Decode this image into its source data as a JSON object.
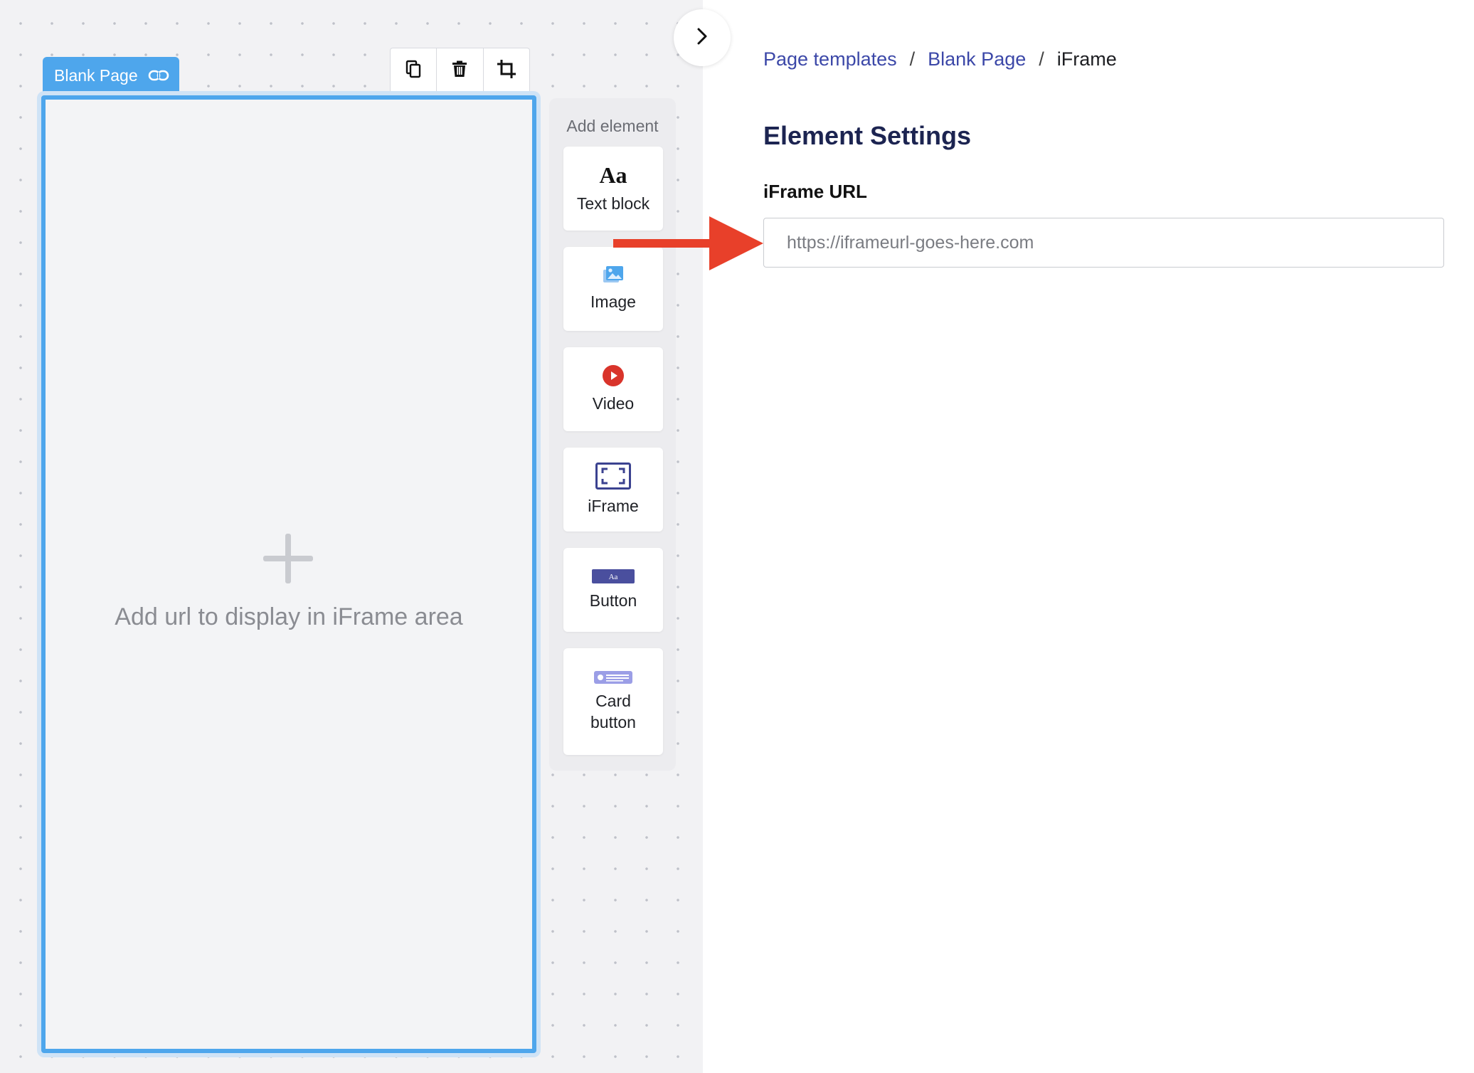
{
  "page_tab": {
    "label": "Blank Page",
    "icon": "link-icon"
  },
  "toolbar": {
    "tools": [
      "copy-icon",
      "trash-icon",
      "crop-icon"
    ]
  },
  "canvas": {
    "placeholder_text": "Add url to display in iFrame area"
  },
  "add_element": {
    "title": "Add element",
    "items": [
      {
        "label": "Text block",
        "icon": "text-block-icon"
      },
      {
        "label": "Image",
        "icon": "image-icon"
      },
      {
        "label": "Video",
        "icon": "video-icon"
      },
      {
        "label": "iFrame",
        "icon": "iframe-icon"
      },
      {
        "label": "Button",
        "icon": "button-icon"
      },
      {
        "label": "Card\nbutton",
        "icon": "card-button-icon"
      }
    ]
  },
  "breadcrumb": {
    "items": [
      "Page templates",
      "Blank Page",
      "iFrame"
    ],
    "separator": "/"
  },
  "settings": {
    "title": "Element Settings",
    "iframe_url_label": "iFrame URL",
    "iframe_url_placeholder": "https://iframeurl-goes-here.com",
    "iframe_url_value": ""
  },
  "colors": {
    "accent_blue": "#4ea6ec",
    "link": "#3c48a8",
    "heading": "#1c2451",
    "annotation_arrow": "#e8402a",
    "video_red": "#d9342b",
    "iframe_navy": "#3b4290",
    "button_navy": "#4a4f9e",
    "card_lavender": "#9b9ee6"
  },
  "aa_glyph": "Aa",
  "button_icon_glyph": "Aa"
}
